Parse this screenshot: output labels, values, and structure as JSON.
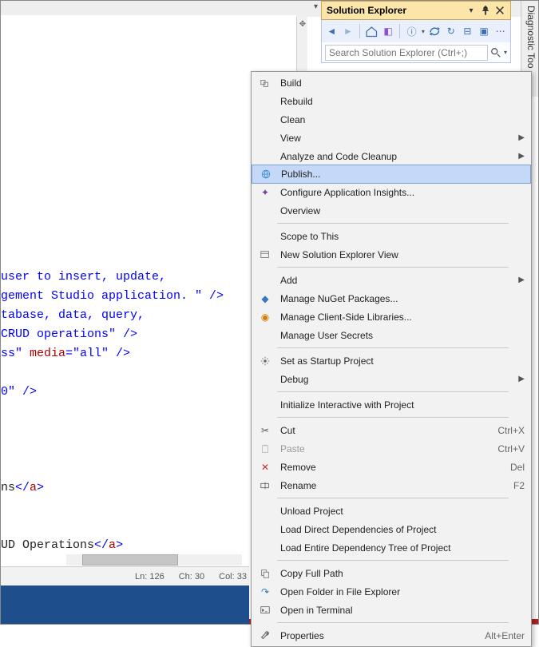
{
  "solutionExplorer": {
    "title": "Solution Explorer",
    "searchPlaceholder": "Search Solution Explorer (Ctrl+;)"
  },
  "diagnosticTab": "Diagnostic Too",
  "code": {
    "line1_a": " user to insert, update,",
    "line2_a": "gement Studio application. \" />",
    "line3_a": "tabase, data, query,",
    "line4_a": "CRUD operations\" />",
    "line5_b": "ss\" ",
    "line5_media": "media",
    "line5_c": "=\"all\" />",
    "line6_a": "0\" />",
    "line7_a": "ns",
    "line7_close": "</",
    "line7_tag": "a",
    "line7_gt": ">",
    "line8_a": "UD Operations",
    "line8_close": "</",
    "line8_tag": "a",
    "line8_gt": ">"
  },
  "status": {
    "ln": "Ln: 126",
    "ch": "Ch: 30",
    "col": "Col: 33"
  },
  "menu": {
    "1": "Build",
    "2": "Rebuild",
    "3": "Clean",
    "4": "View",
    "5": "Analyze and Code Cleanup",
    "6": "Publish...",
    "7": "Configure Application Insights...",
    "8": "Overview",
    "9": "Scope to This",
    "10": "New Solution Explorer View",
    "11": "Add",
    "12": "Manage NuGet Packages...",
    "13": "Manage Client-Side Libraries...",
    "14": "Manage User Secrets",
    "15": "Set as Startup Project",
    "16": "Debug",
    "17": "Initialize Interactive with Project",
    "18": "Cut",
    "18s": "Ctrl+X",
    "19": "Paste",
    "19s": "Ctrl+V",
    "20": "Remove",
    "20s": "Del",
    "21": "Rename",
    "21s": "F2",
    "22": "Unload Project",
    "23": "Load Direct Dependencies of Project",
    "24": "Load Entire Dependency Tree of Project",
    "25": "Copy Full Path",
    "26": "Open Folder in File Explorer",
    "27": "Open in Terminal",
    "28": "Properties",
    "28s": "Alt+Enter"
  }
}
